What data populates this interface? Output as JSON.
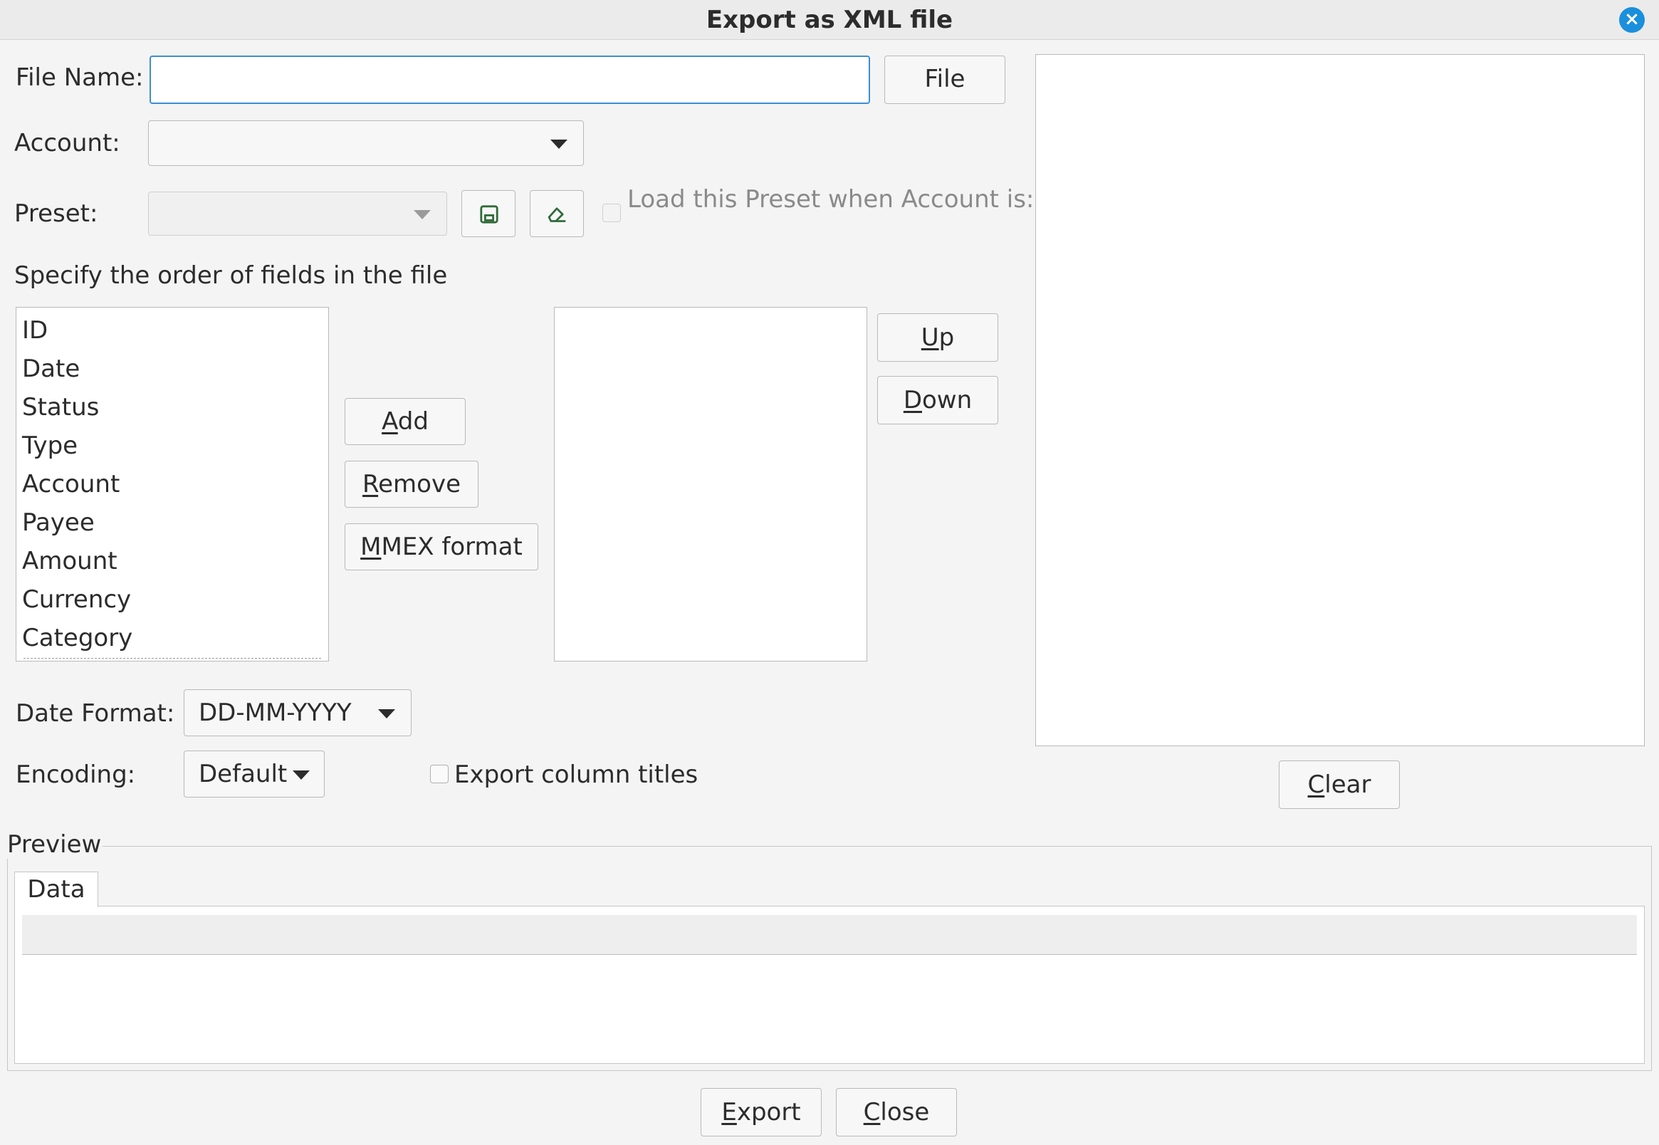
{
  "window": {
    "title": "Export as XML file"
  },
  "file": {
    "label": "File Name:",
    "value": "",
    "button": "File"
  },
  "account": {
    "label": "Account:",
    "value": ""
  },
  "preset": {
    "label": "Preset:",
    "value": "",
    "load_label": "Load this Preset when Account is:"
  },
  "fields": {
    "heading": "Specify the order of fields in the file",
    "available": [
      "ID",
      "Date",
      "Status",
      "Type",
      "Account",
      "Payee",
      "Amount",
      "Currency",
      "Category"
    ],
    "add": {
      "mnemonic": "A",
      "rest": "dd"
    },
    "remove": {
      "mnemonic": "R",
      "rest": "emove"
    },
    "mmex": {
      "mnemonic": "M",
      "rest": "MEX format"
    },
    "up": {
      "mnemonic": "U",
      "rest": "p"
    },
    "down": {
      "mnemonic": "D",
      "rest": "own"
    }
  },
  "date_format": {
    "label": "Date Format:",
    "value": "DD-MM-YYYY"
  },
  "encoding": {
    "label": "Encoding:",
    "value": "Default"
  },
  "export_titles": {
    "label": "Export column titles",
    "checked": false
  },
  "clear": {
    "mnemonic": "C",
    "rest": "lear"
  },
  "preview": {
    "label": "Preview",
    "tab": "Data"
  },
  "actions": {
    "export": {
      "mnemonic": "E",
      "rest": "xport"
    },
    "close": {
      "mnemonic": "C",
      "rest": "lose"
    }
  },
  "colors": {
    "accent": "#1a8fdc",
    "focus_border": "#3b8ed6"
  },
  "icons": {
    "window_close": "close-icon",
    "save_preset": "save-icon",
    "clear_preset": "eraser-icon"
  }
}
